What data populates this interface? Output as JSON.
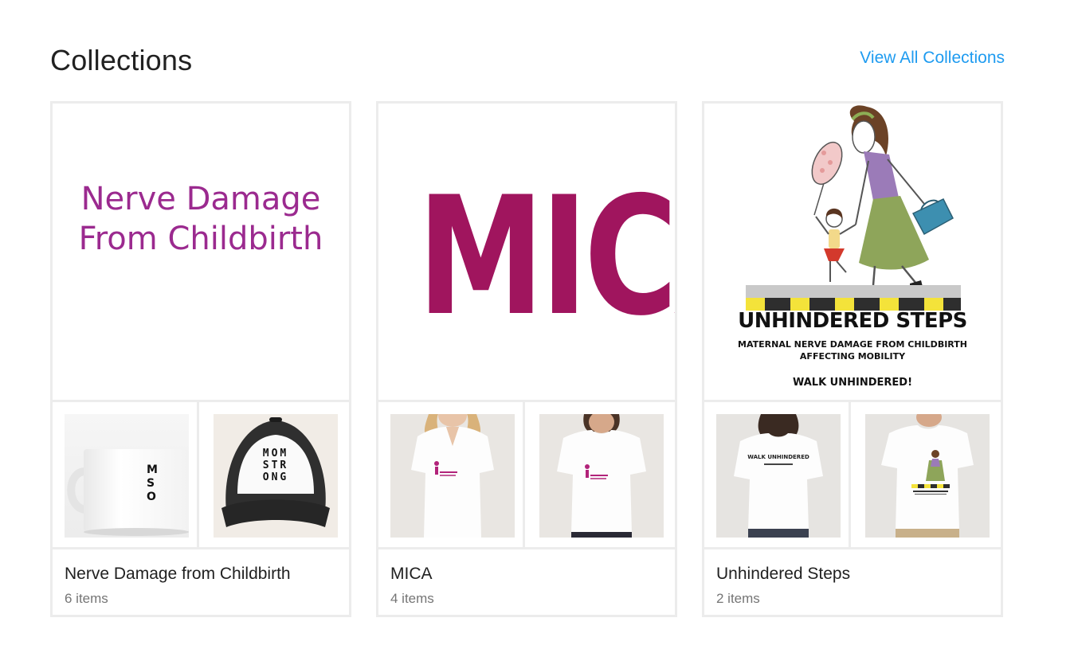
{
  "header": {
    "title": "Collections",
    "view_all_label": "View All Collections"
  },
  "collections": [
    {
      "name": "Nerve Damage from Childbirth",
      "count": "6 items",
      "hero_text": [
        "Nerve Damage",
        "From Childbirth"
      ],
      "hero_color": "#9b2a8f",
      "thumbs": [
        {
          "kind": "mug",
          "print": [
            "M",
            "S",
            "O"
          ]
        },
        {
          "kind": "trucker-hat",
          "print": [
            "MOM",
            "STR",
            "ONG"
          ]
        }
      ]
    },
    {
      "name": "MICA",
      "count": "4 items",
      "hero_text": "MICA",
      "hero_color": "#a0155e",
      "thumbs": [
        {
          "kind": "womens-vneck-tshirt"
        },
        {
          "kind": "womens-crew-tshirt"
        }
      ]
    },
    {
      "name": "Unhindered Steps",
      "count": "2 items",
      "hero_title": "UNHINDERED STEPS",
      "hero_sub": [
        "MATERNAL NERVE DAMAGE FROM CHILDBIRTH",
        "AFFECTING MOBILITY"
      ],
      "hero_tagline": "WALK UNHINDERED!",
      "thumbs": [
        {
          "kind": "womens-tshirt-back",
          "print": "WALK UNHINDERED"
        },
        {
          "kind": "kids-tshirt"
        }
      ]
    }
  ],
  "colors": {
    "link": "#1e9bf0",
    "border": "#ececec",
    "title": "#212121",
    "muted": "#757575"
  }
}
